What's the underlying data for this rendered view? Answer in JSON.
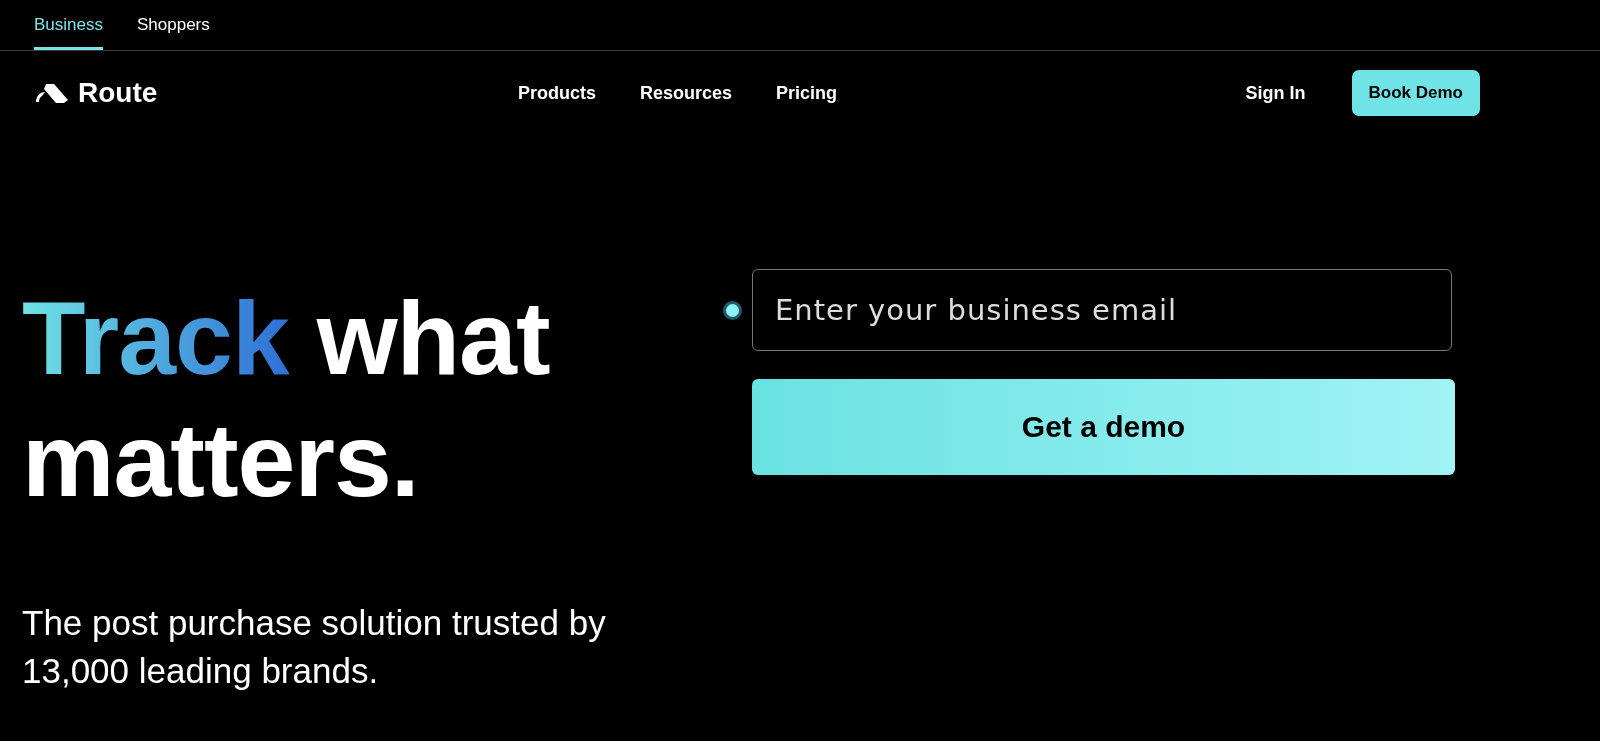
{
  "audience_tabs": [
    {
      "label": "Business",
      "selected": true
    },
    {
      "label": "Shoppers",
      "selected": false
    }
  ],
  "nav": {
    "brand": "Route",
    "links": [
      "Products",
      "Resources",
      "Pricing"
    ],
    "sign_in": "Sign In",
    "cta": "Book Demo"
  },
  "hero": {
    "headline_accent": "Track",
    "headline_rest": "what matters.",
    "subtitle": "The post purchase solution trusted by 13,000 leading brands."
  },
  "form": {
    "placeholder": "Enter your business email",
    "button": "Get a demo"
  }
}
